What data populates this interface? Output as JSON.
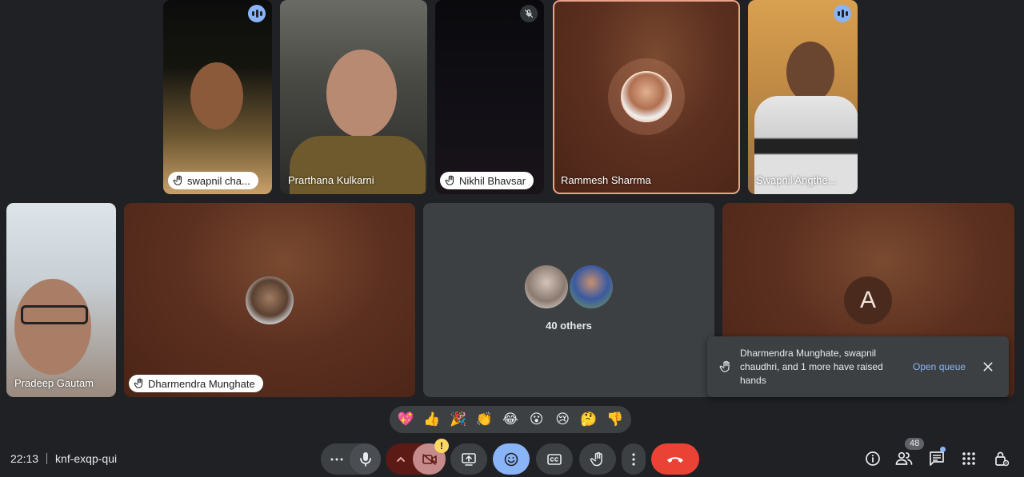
{
  "tiles": {
    "t1": {
      "name": "swapnil cha..."
    },
    "t2": {
      "name": "Prarthana Kulkarni"
    },
    "t3": {
      "name": "Nikhil Bhavsar"
    },
    "t4": {
      "name": "Rammesh Sharrma"
    },
    "t5": {
      "name": "Swapnil Angthe..."
    },
    "t6": {
      "name": "Pradeep Gautam"
    },
    "t7": {
      "name": "Dharmendra Munghate"
    },
    "t8": {
      "others_label": "40 others"
    },
    "t9": {
      "avatar_letter": "A"
    }
  },
  "toast": {
    "message": "Dharmendra Munghate, swapnil chaudhri, and 1 more have raised hands",
    "action": "Open queue"
  },
  "reactions": [
    "💖",
    "👍",
    "🎉",
    "👏",
    "😂",
    "😮",
    "😢",
    "🤔",
    "👎"
  ],
  "meeting": {
    "time": "22:13",
    "code": "knf-exqp-qui"
  },
  "controls": {
    "camera_warning": "!",
    "people_count": "48"
  },
  "colors": {
    "background": "#202124",
    "end_call": "#ea4335",
    "accent_blue": "#8ab4f8",
    "camera_off": "#c58a8a"
  }
}
